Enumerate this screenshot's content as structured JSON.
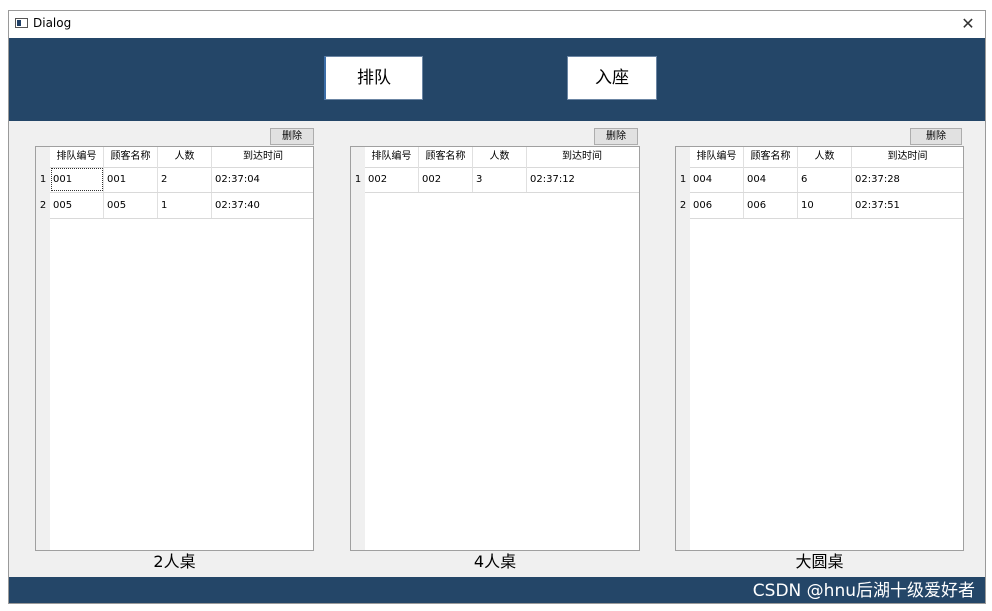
{
  "window": {
    "title": "Dialog",
    "close_glyph": "✕"
  },
  "toolbar": {
    "queue_label": "排队",
    "seat_label": "入座"
  },
  "columns": [
    "排队编号",
    "顾客名称",
    "人数",
    "到达时间"
  ],
  "panels": [
    {
      "delete_label": "删除",
      "caption": "2人桌",
      "rows": [
        {
          "num": "1",
          "cells": [
            "001",
            "001",
            "2",
            "02:37:04"
          ]
        },
        {
          "num": "2",
          "cells": [
            "005",
            "005",
            "1",
            "02:37:40"
          ]
        }
      ]
    },
    {
      "delete_label": "删除",
      "caption": "4人桌",
      "rows": [
        {
          "num": "1",
          "cells": [
            "002",
            "002",
            "3",
            "02:37:12"
          ]
        }
      ]
    },
    {
      "delete_label": "删除",
      "caption": "大圆桌",
      "rows": [
        {
          "num": "1",
          "cells": [
            "004",
            "004",
            "6",
            "02:37:28"
          ]
        },
        {
          "num": "2",
          "cells": [
            "006",
            "006",
            "10",
            "02:37:51"
          ]
        }
      ]
    }
  ],
  "footer": {
    "watermark": "CSDN @hnu后湖十级爱好者"
  },
  "colors": {
    "band": "#244668",
    "window_bg": "#f0f0f0"
  }
}
